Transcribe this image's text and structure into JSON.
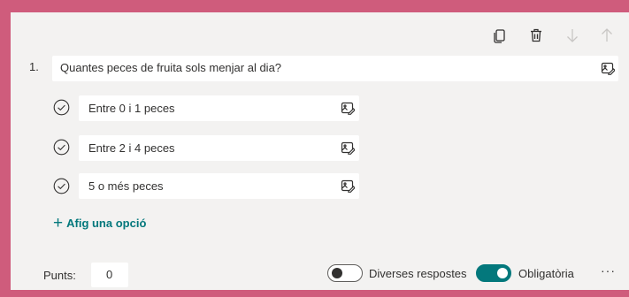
{
  "colors": {
    "frame_border": "#cf5c7c",
    "card_background": "#f3f2f1",
    "accent": "#03787c"
  },
  "toolbar": {
    "icons": [
      "copy-icon",
      "delete-icon",
      "arrow-down-icon",
      "arrow-up-icon"
    ]
  },
  "question": {
    "number": "1.",
    "text": "Quantes peces de fruita sols menjar al dia?"
  },
  "options": [
    {
      "label": "Entre 0 i 1 peces"
    },
    {
      "label": "Entre 2 i 4 peces"
    },
    {
      "label": "5 o més peces"
    }
  ],
  "add_option": {
    "label": "Afig una opció"
  },
  "footer": {
    "points_label": "Punts:",
    "points_value": "0",
    "multiple_answers_label": "Diverses respostes",
    "multiple_answers_on": false,
    "required_label": "Obligatòria",
    "required_on": true,
    "more_label": "···"
  }
}
